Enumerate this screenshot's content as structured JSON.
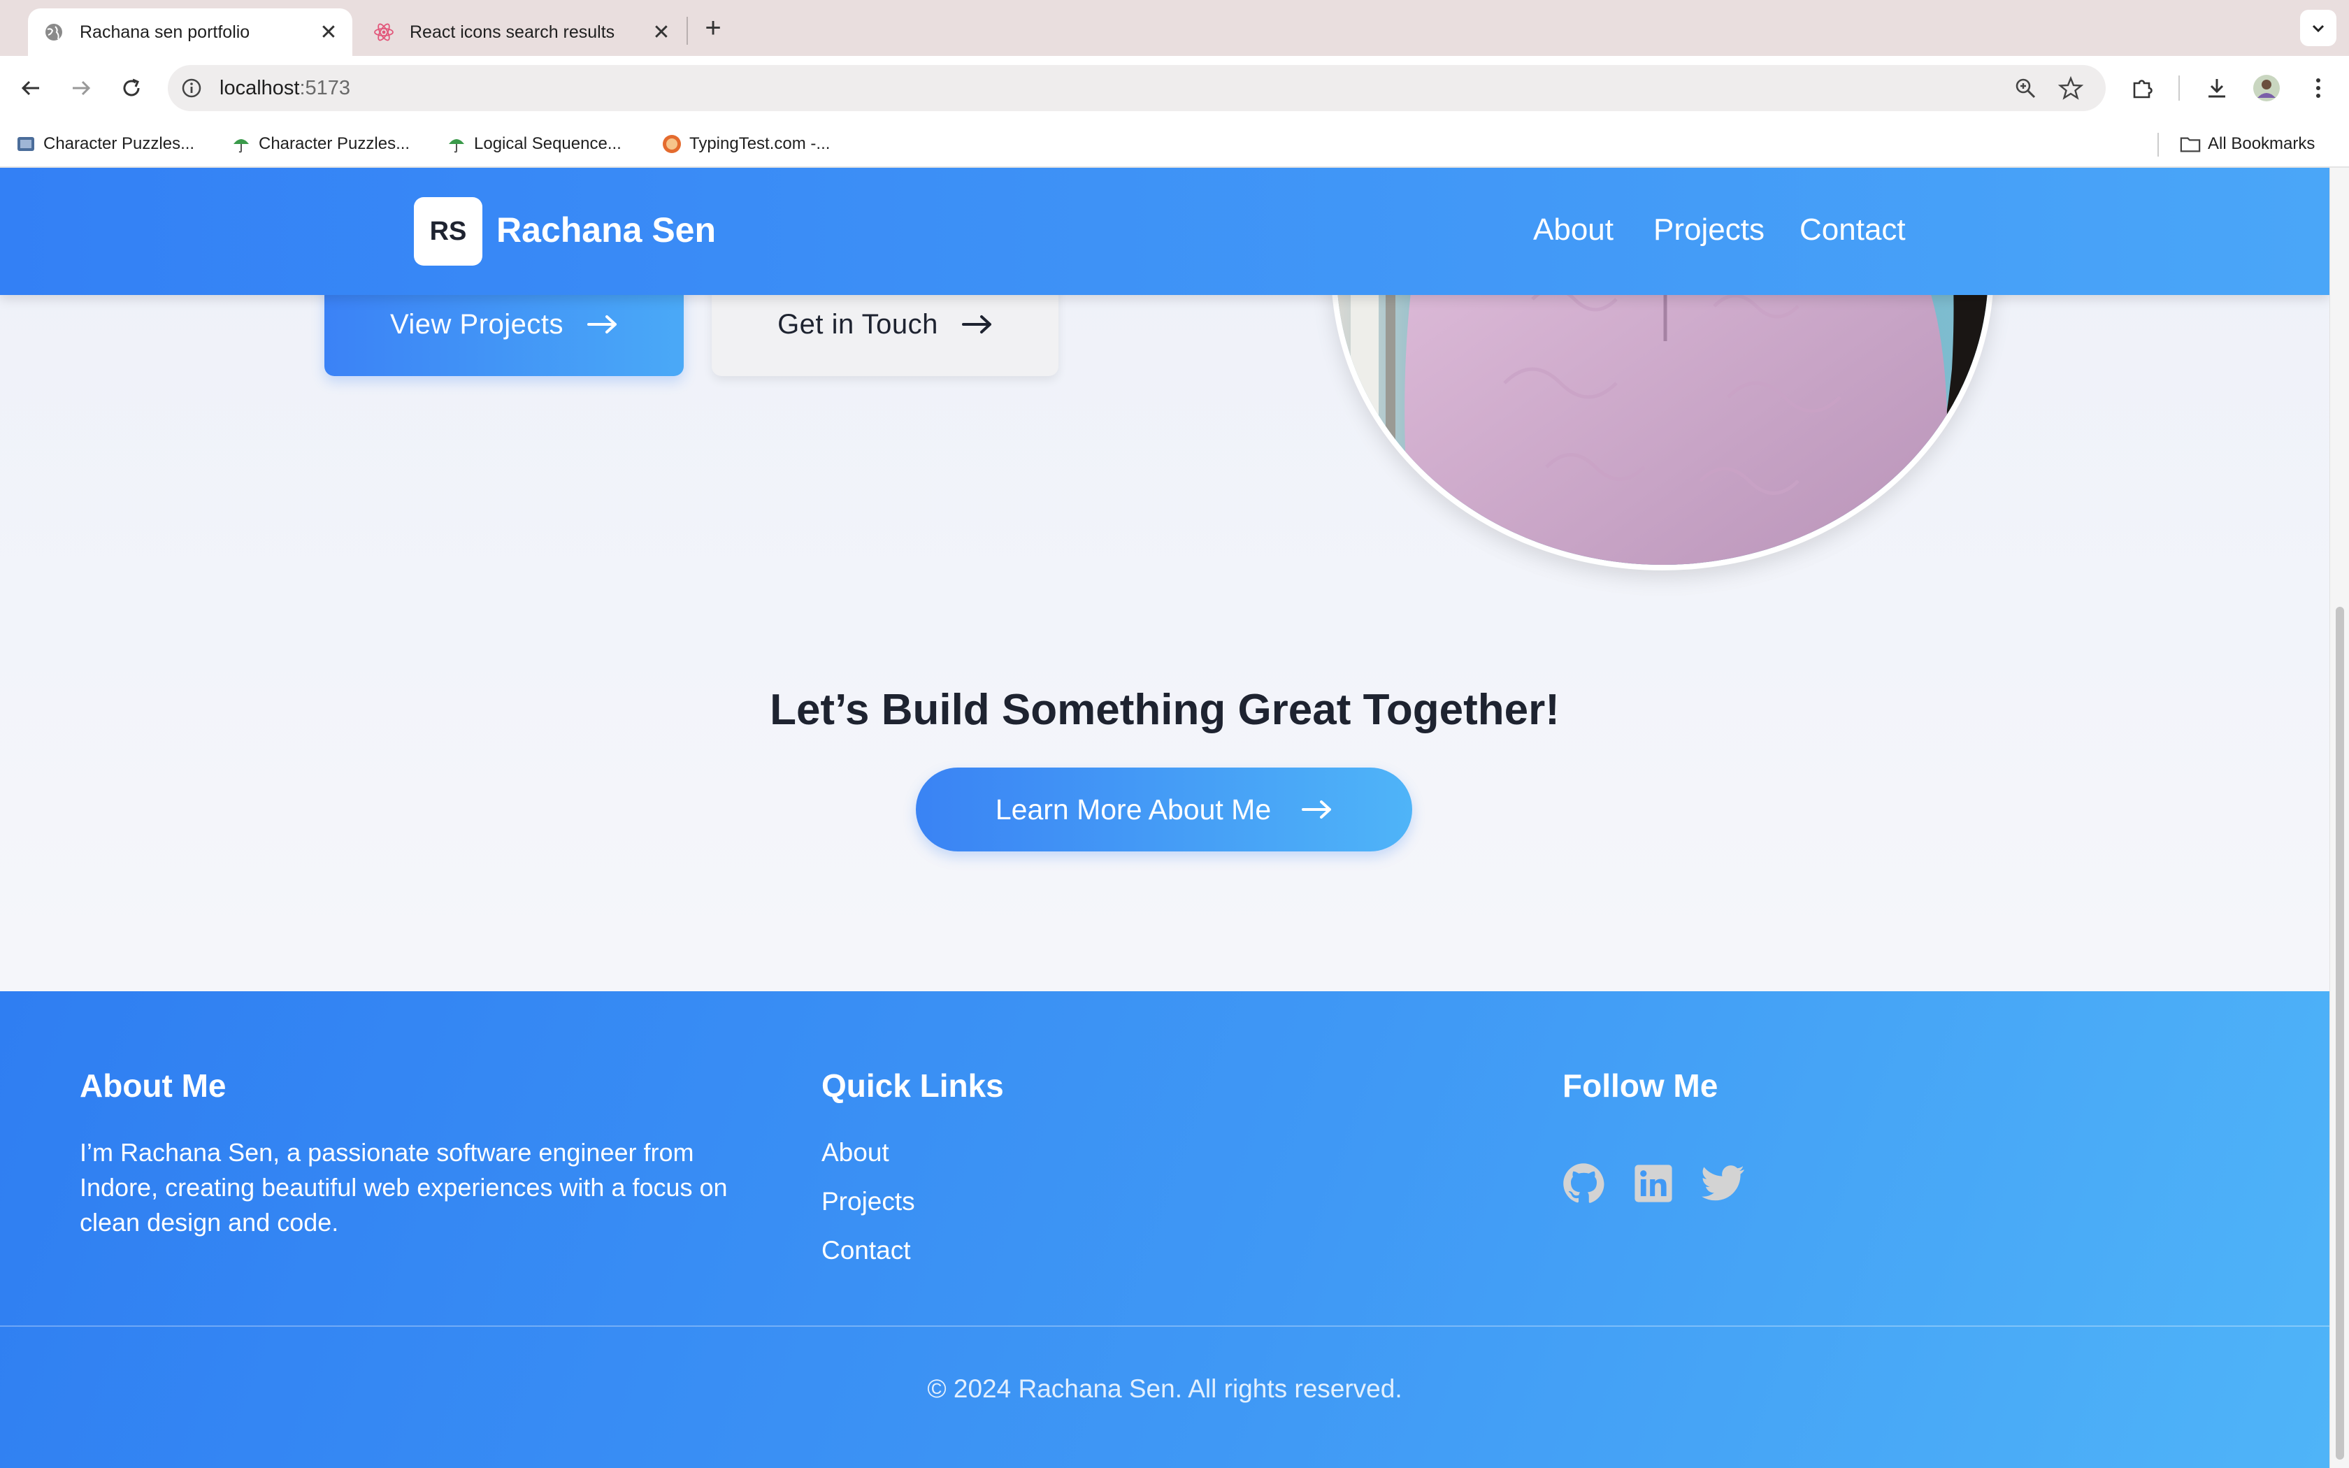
{
  "browser": {
    "tabs": [
      {
        "title": "Rachana sen portfolio",
        "active": true
      },
      {
        "title": "React icons search results",
        "active": false
      }
    ],
    "address": {
      "host": "localhost",
      "port": ":5173"
    },
    "bookmarks": [
      {
        "label": "Character Puzzles..."
      },
      {
        "label": "Character Puzzles..."
      },
      {
        "label": "Logical Sequence..."
      },
      {
        "label": "TypingTest.com -..."
      }
    ],
    "all_bookmarks": "All Bookmarks"
  },
  "navbar": {
    "logo_initials": "RS",
    "logo_name": "Rachana Sen",
    "links": [
      "About",
      "Projects",
      "Contact"
    ]
  },
  "hero": {
    "primary_button": "View Projects",
    "secondary_button": "Get in Touch"
  },
  "cta": {
    "title": "Let’s Build Something Great Together!",
    "button": "Learn More About Me"
  },
  "footer": {
    "about_title": "About Me",
    "about_text": "I’m Rachana Sen, a passionate software engineer from Indore, creating beautiful web experiences with a focus on clean design and code.",
    "links_title": "Quick Links",
    "links": [
      "About",
      "Projects",
      "Contact"
    ],
    "follow_title": "Follow Me",
    "social": [
      "github-icon",
      "linkedin-icon",
      "twitter-icon"
    ],
    "copyright": "© 2024 Rachana Sen. All rights reserved."
  },
  "colors": {
    "brand_blue": "#3380f5",
    "brand_blue_light": "#4fb4f8",
    "text_dark": "#1e2330",
    "social_icon": "#d3d3d3"
  }
}
